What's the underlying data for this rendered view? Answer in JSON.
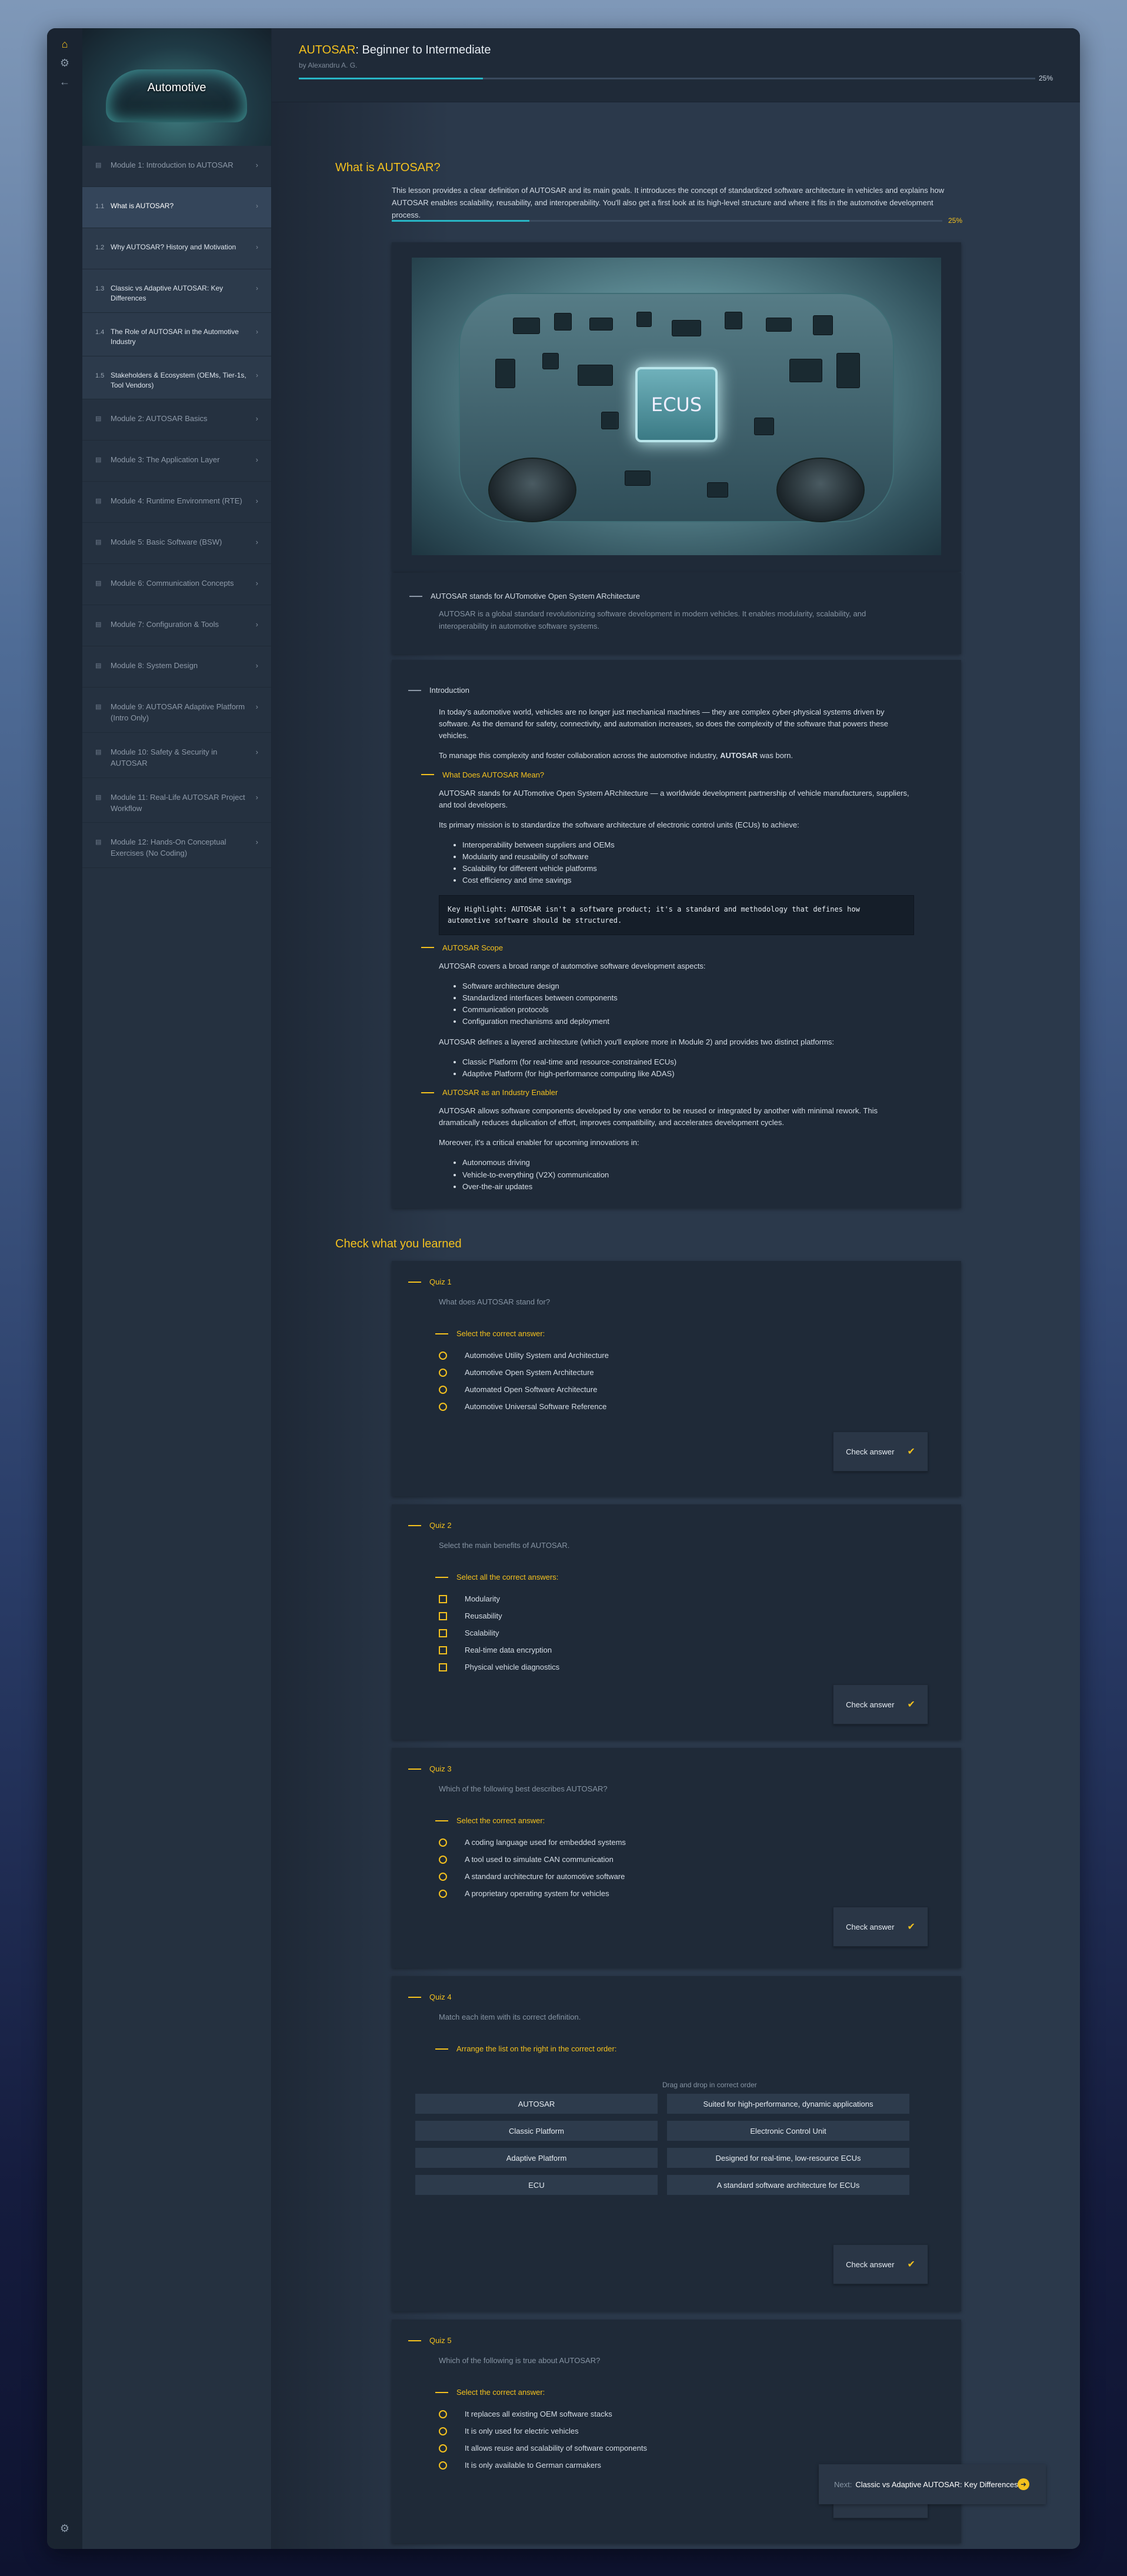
{
  "course": {
    "title_brand": "AUTOSAR",
    "title_rest": ": Beginner to Intermediate",
    "author": "by Alexandru A. G.",
    "progress_pct": 25,
    "progress_label": "25%"
  },
  "rail": {
    "home_icon": "home-icon",
    "gear_icon": "gear-icon",
    "back_icon": "back-arrow-icon",
    "bottom_icon": "settings-icon"
  },
  "sidebar": {
    "header": "Automotive",
    "items": [
      {
        "num": "▤",
        "label": "Module 1: Introduction to AUTOSAR",
        "type": "module"
      },
      {
        "num": "1.1",
        "label": "What is AUTOSAR?",
        "type": "sub",
        "active": true
      },
      {
        "num": "1.2",
        "label": "Why AUTOSAR? History and Motivation",
        "type": "sub"
      },
      {
        "num": "1.3",
        "label": "Classic vs Adaptive AUTOSAR: Key Differences",
        "type": "sub"
      },
      {
        "num": "1.4",
        "label": "The Role of AUTOSAR in the Automotive Industry",
        "type": "sub"
      },
      {
        "num": "1.5",
        "label": "Stakeholders & Ecosystem (OEMs, Tier-1s, Tool Vendors)",
        "type": "sub"
      },
      {
        "num": "▤",
        "label": "Module 2: AUTOSAR Basics",
        "type": "module"
      },
      {
        "num": "▤",
        "label": "Module 3: The Application Layer",
        "type": "module"
      },
      {
        "num": "▤",
        "label": "Module 4: Runtime Environment (RTE)",
        "type": "module"
      },
      {
        "num": "▤",
        "label": "Module 5: Basic Software (BSW)",
        "type": "module"
      },
      {
        "num": "▤",
        "label": "Module 6: Communication Concepts",
        "type": "module"
      },
      {
        "num": "▤",
        "label": "Module 7: Configuration & Tools",
        "type": "module"
      },
      {
        "num": "▤",
        "label": "Module 8: System Design",
        "type": "module"
      },
      {
        "num": "▤",
        "label": "Module 9: AUTOSAR Adaptive Platform (Intro Only)",
        "type": "module"
      },
      {
        "num": "▤",
        "label": "Module 10: Safety & Security in AUTOSAR",
        "type": "module"
      },
      {
        "num": "▤",
        "label": "Module 11: Real-Life AUTOSAR Project Workflow",
        "type": "module"
      },
      {
        "num": "▤",
        "label": "Module 12: Hands-On Conceptual Exercises (No Coding)",
        "type": "module"
      }
    ]
  },
  "lesson": {
    "heading": "What is AUTOSAR?",
    "intro": "This lesson provides a clear definition of AUTOSAR and its main goals. It introduces the concept of standardized software architecture in vehicles and explains how AUTOSAR enables scalability, reusability, and interoperability. You'll also get a first look at its high-level structure and where it fits in the automotive development process.",
    "progress_label": "25%",
    "progress_pct": 25,
    "image_label": "ECUS",
    "caption_title": "AUTOSAR stands for AUTomotive Open System ARchitecture",
    "caption_text": "AUTOSAR is a global standard revolutionizing software development in modern vehicles. It enables modularity, scalability, and interoperability in automotive software systems.",
    "body_heading": "Introduction",
    "p1": "In today's automotive world, vehicles are no longer just mechanical machines — they are complex cyber-physical systems driven by software. As the demand for safety, connectivity, and automation increases, so does the complexity of the software that powers these vehicles.",
    "p2_pre": "To manage this complexity and foster collaboration across the automotive industry, ",
    "p2_bold": "AUTOSAR",
    "p2_post": " was born.",
    "h_meaning": "What Does AUTOSAR Mean?",
    "p3": "AUTOSAR stands for AUTomotive Open System ARchitecture — a worldwide development partnership of vehicle manufacturers, suppliers, and tool developers.",
    "p4": "Its primary mission is to standardize the software architecture of electronic control units (ECUs) to achieve:",
    "list1": [
      "Interoperability between suppliers and OEMs",
      "Modularity and reusability of software",
      "Scalability for different vehicle platforms",
      "Cost efficiency and time savings"
    ],
    "code": "Key Highlight: AUTOSAR isn't a software product; it's a standard and methodology that defines how automotive software should be structured.",
    "h_scope": "AUTOSAR Scope",
    "p5": "AUTOSAR covers a broad range of automotive software development aspects:",
    "list2": [
      "Software architecture design",
      "Standardized interfaces between components",
      "Communication protocols",
      "Configuration mechanisms and deployment"
    ],
    "p6": "AUTOSAR defines a layered architecture (which you'll explore more in Module 2) and provides two distinct platforms:",
    "list3": [
      "Classic Platform (for real-time and resource-constrained ECUs)",
      "Adaptive Platform (for high-performance computing like ADAS)"
    ],
    "h_enabler": "AUTOSAR as an Industry Enabler",
    "p7": "AUTOSAR allows software components developed by one vendor to be reused or integrated by another with minimal rework. This dramatically reduces duplication of effort, improves compatibility, and accelerates development cycles.",
    "p8": "Moreover, it's a critical enabler for upcoming innovations in:",
    "list4": [
      "Autonomous driving",
      "Vehicle-to-everything (V2X) communication",
      "Over-the-air updates"
    ]
  },
  "check": {
    "heading": "Check what you learned",
    "check_label": "Check answer",
    "quizzes": [
      {
        "title": "Quiz 1",
        "question": "What does AUTOSAR stand for?",
        "instruction": "Select the correct answer:",
        "options": [
          "Automotive Utility System and Architecture",
          "Automotive Open System Architecture",
          "Automated Open Software Architecture",
          "Automotive Universal Software Reference"
        ]
      },
      {
        "title": "Quiz 2",
        "question": "Select the main benefits of AUTOSAR.",
        "instruction": "Select all the correct answers:",
        "options": [
          "Modularity",
          "Reusability",
          "Scalability",
          "Real-time data encryption",
          "Physical vehicle diagnostics"
        ]
      },
      {
        "title": "Quiz 3",
        "question": "Which of the following best describes AUTOSAR?",
        "instruction": "Select the correct answer:",
        "options": [
          "A coding language used for embedded systems",
          "A tool used to simulate CAN communication",
          "A standard architecture for automotive software",
          "A proprietary operating system for vehicles"
        ]
      },
      {
        "title": "Quiz 4",
        "question": "Match each item with its correct definition.",
        "instruction": "Arrange the list on the right in the correct order:",
        "dd_hint": "Drag and drop in correct order",
        "left": [
          "AUTOSAR",
          "Classic Platform",
          "Adaptive Platform",
          "ECU"
        ],
        "right": [
          "Suited for high-performance, dynamic applications",
          "Electronic Control Unit",
          "Designed for real-time, low-resource ECUs",
          "A standard software architecture for ECUs"
        ]
      },
      {
        "title": "Quiz 5",
        "question": "Which of the following is true about AUTOSAR?",
        "instruction": "Select the correct answer:",
        "options": [
          "It replaces all existing OEM software stacks",
          "It is only used for electric vehicles",
          "It allows reuse and scalability of software components",
          "It is only available to German carmakers"
        ]
      }
    ]
  },
  "next": {
    "prefix": "Next:",
    "label": "Classic vs Adaptive AUTOSAR: Key Differences"
  },
  "colors": {
    "accent": "#f4c11e",
    "progress": "#28b5c5",
    "panel": "#1f2a38"
  }
}
